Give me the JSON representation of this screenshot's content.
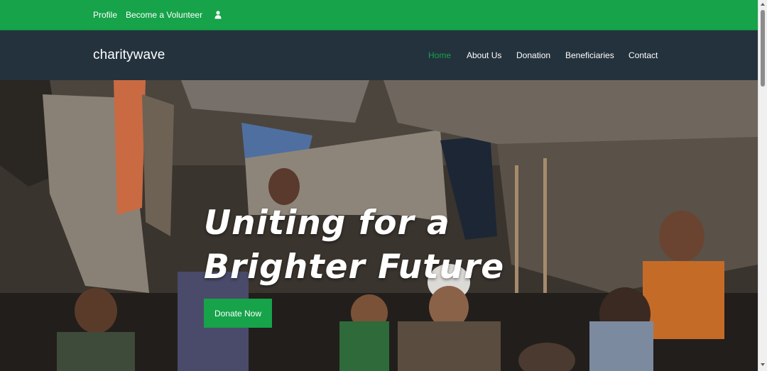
{
  "topbar": {
    "profile_label": "Profile",
    "volunteer_label": "Become a Volunteer",
    "user_icon": "user-icon",
    "background_color": "#16a34a"
  },
  "navbar": {
    "brand": "charitywave",
    "items": [
      {
        "label": "Home",
        "active": true
      },
      {
        "label": "About Us",
        "active": false
      },
      {
        "label": "Donation",
        "active": false
      },
      {
        "label": "Beneficiaries",
        "active": false
      },
      {
        "label": "Contact",
        "active": false
      }
    ],
    "background_color": "#24323d",
    "active_color": "#16a34a"
  },
  "hero": {
    "title_line1": "Uniting for a",
    "title_line2": "Brighter Future",
    "button_label": "Donate Now",
    "button_color": "#16a34a"
  }
}
